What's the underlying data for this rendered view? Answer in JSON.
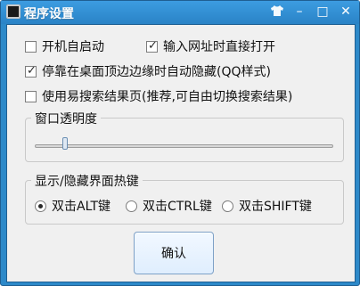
{
  "window": {
    "title": "程序设置",
    "controls": {
      "skin": "shirt-icon",
      "minimize": "–",
      "maximize": "□",
      "close": "✕"
    }
  },
  "options": {
    "autostart": {
      "label": "开机自启动",
      "checked": false
    },
    "open_url_directly": {
      "label": "输入网址时直接打开",
      "checked": true
    },
    "auto_hide": {
      "label": "停靠在桌面顶边边缘时自动隐藏(QQ样式)",
      "checked": true
    },
    "use_search_page": {
      "label": "使用易搜索结果页(推荐,可自由切换搜索结果)",
      "checked": false
    }
  },
  "transparency": {
    "group_title": "窗口透明度",
    "level_percent": 10
  },
  "hotkey": {
    "group_title": "显示/隐藏界面热键",
    "options": [
      {
        "label": "双击ALT键",
        "selected": true
      },
      {
        "label": "双击CTRL键",
        "selected": false
      },
      {
        "label": "双击SHIFT键",
        "selected": false
      }
    ]
  },
  "buttons": {
    "ok_label": "确认"
  }
}
